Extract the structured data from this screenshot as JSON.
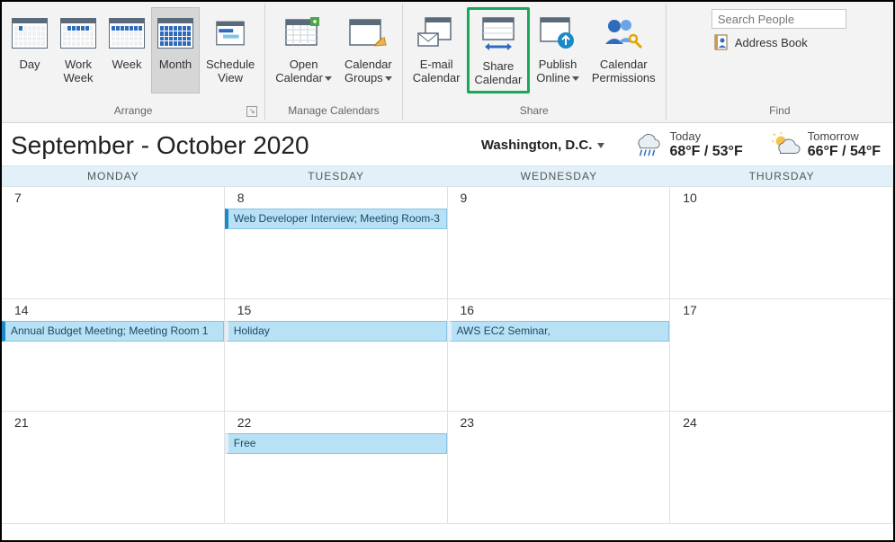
{
  "ribbon": {
    "arrange": {
      "caption": "Arrange",
      "buttons": {
        "day": "Day",
        "workwk": "Work\nWeek",
        "week": "Week",
        "month": "Month",
        "sched": "Schedule\nView"
      }
    },
    "manage": {
      "caption": "Manage Calendars",
      "buttons": {
        "open": "Open\nCalendar",
        "groups": "Calendar\nGroups"
      }
    },
    "share": {
      "caption": "Share",
      "buttons": {
        "email": "E-mail\nCalendar",
        "share": "Share\nCalendar",
        "publish": "Publish\nOnline",
        "perm": "Calendar\nPermissions"
      }
    },
    "find": {
      "caption": "Find",
      "placeholder": "Search People",
      "addressbook": "Address Book"
    }
  },
  "header": {
    "title": "September - October 2020",
    "location": "Washington,  D.C.",
    "today": {
      "label": "Today",
      "temp": "68°F / 53°F"
    },
    "tomorrow": {
      "label": "Tomorrow",
      "temp": "66°F / 54°F"
    }
  },
  "dayNames": [
    "MONDAY",
    "TUESDAY",
    "WEDNESDAY",
    "THURSDAY"
  ],
  "cells": [
    {
      "date": "7"
    },
    {
      "date": "8",
      "event": "Web Developer Interview;\nMeeting Room-3"
    },
    {
      "date": "9"
    },
    {
      "date": "10"
    },
    {
      "date": "14",
      "event": "Annual Budget Meeting; Meeting Room 1"
    },
    {
      "date": "15",
      "event": "Holiday"
    },
    {
      "date": "16",
      "event": "AWS EC2 Seminar,"
    },
    {
      "date": "17"
    },
    {
      "date": "21"
    },
    {
      "date": "22",
      "event": "Free"
    },
    {
      "date": "23"
    },
    {
      "date": "24"
    }
  ]
}
